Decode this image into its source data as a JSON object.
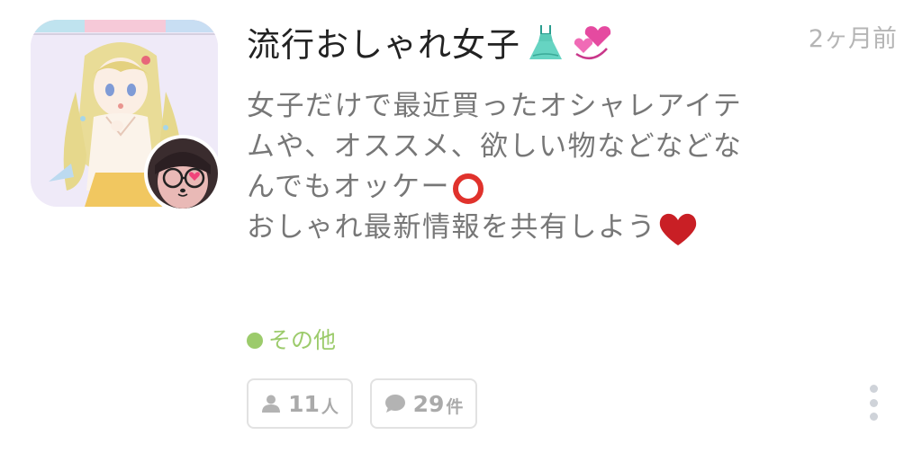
{
  "post": {
    "title": "流行おしゃれ女子",
    "time": "2ヶ月前",
    "description_lines": [
      "女子だけで最近買ったオシャレアイテ",
      "ムや、オススメ、欲しい物などなどな",
      "んでもオッケー",
      "おしゃれ最新情報を共有しよう"
    ],
    "category": "その他",
    "members_count": "11",
    "members_unit": "人",
    "comments_count": "29",
    "comments_unit": "件"
  },
  "icons": {
    "title_emojis": [
      "dress-icon",
      "revolving-hearts-icon"
    ],
    "desc_emojis": [
      "red-circle-icon",
      "red-heart-icon"
    ],
    "members": "person-icon",
    "comments": "speech-bubble-icon",
    "more": "vertical-dots-icon"
  },
  "colors": {
    "title": "#222222",
    "description": "#777777",
    "time": "#b5b5b5",
    "category": "#9ccb6b",
    "stat_text": "#aaaaaa",
    "border": "#e2e2e2"
  }
}
